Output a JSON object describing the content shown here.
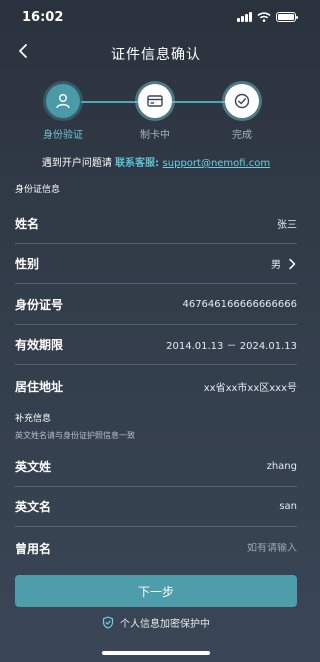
{
  "status": {
    "time": "16:02"
  },
  "nav": {
    "title": "证件信息确认"
  },
  "steps": [
    {
      "label": "身份验证",
      "state": "active",
      "icon": "person-icon"
    },
    {
      "label": "制卡中",
      "state": "pending",
      "icon": "card-icon"
    },
    {
      "label": "完成",
      "state": "pending",
      "icon": "check-icon"
    }
  ],
  "help": {
    "prefix": "遇到开户问题请 ",
    "service_label": "联系客服: ",
    "email": "support@nemofi.com"
  },
  "id_section": {
    "title": "身份证信息",
    "fields": [
      {
        "label": "姓名",
        "value": "张三"
      },
      {
        "label": "性别",
        "value": "男"
      },
      {
        "label": "身份证号",
        "value": "467646166666666666"
      },
      {
        "label": "有效期限",
        "value": "2014.01.13 － 2024.01.13"
      },
      {
        "label": "居住地址",
        "value": "xx省xx市xx区xxx号"
      }
    ]
  },
  "supplement": {
    "title": "补充信息",
    "subtitle": "英文姓名请与身份证护照信息一致",
    "fields": [
      {
        "label": "英文姓",
        "value": "zhang"
      },
      {
        "label": "英文名",
        "value": "san"
      },
      {
        "label": "曾用名",
        "placeholder": "如有请输入"
      }
    ]
  },
  "next_button": "下一步",
  "secure_text": "个人信息加密保护中",
  "colors": {
    "accent": "#4d9dab",
    "link": "#6ecfe0"
  }
}
